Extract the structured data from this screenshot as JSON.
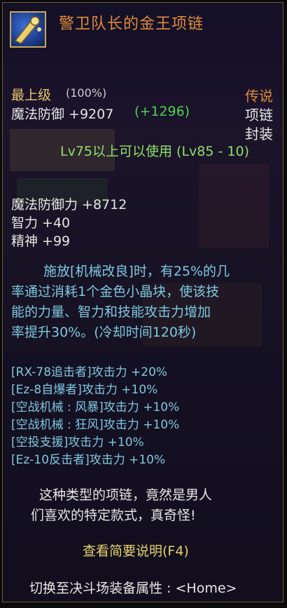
{
  "item": {
    "name": "警卫队长的金王项链",
    "icon": "necklace-icon"
  },
  "grade": {
    "label": "最上级",
    "percent": "(100%)"
  },
  "rarity": "传说",
  "type": "项链",
  "bind": "封装",
  "base_stat": {
    "label": "魔法防御 +9207",
    "bonus": "(+1296)"
  },
  "requirement": "Lv75以上可以使用 (Lv85 - 10)",
  "stats": [
    "魔法防御力 +8712",
    "智力 +40",
    "精神 +99"
  ],
  "skill_lines": [
    "施放[机械改良]时，有25%的几",
    "率通过消耗1个金色小晶块，使该技",
    "能的力量、智力和技能攻击力增加",
    "率提升30%。(冷却时间120秒)"
  ],
  "bonuses": [
    "[RX-78追击者]攻击力 +20%",
    "[Ez-8自爆者]攻击力 +10%",
    "[空战机械 : 风暴]攻击力 +10%",
    "[空战机械 : 狂风]攻击力 +10%",
    "[空投支援]攻击力 +10%",
    "[Ez-10反击者]攻击力 +10%"
  ],
  "flavor_lines": [
    "这种类型的项链，竟然是男人",
    "们喜欢的特定款式，真奇怪!"
  ],
  "hint_summary": "查看简要说明(F4)",
  "hint_switch": "切换至决斗场装备属性 : <Home>",
  "colors": {
    "title": "#e08a3a",
    "grade": "#e8c66a",
    "green": "#4fd24f",
    "skill": "#7ec8e0",
    "hint": "#e6d36a"
  }
}
